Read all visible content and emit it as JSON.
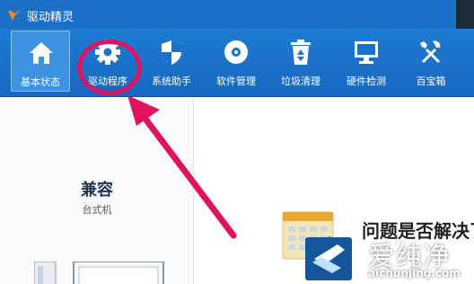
{
  "app": {
    "title": "驱动精灵"
  },
  "toolbar": {
    "items": [
      {
        "label": "基本状态",
        "icon": "home-icon",
        "active": true
      },
      {
        "label": "驱动程序",
        "icon": "gear-icon",
        "active": false
      },
      {
        "label": "系统助手",
        "icon": "shield-icon",
        "active": false
      },
      {
        "label": "软件管理",
        "icon": "disc-icon",
        "active": false
      },
      {
        "label": "垃圾清理",
        "icon": "recycle-bin-icon",
        "active": false
      },
      {
        "label": "硬件检测",
        "icon": "monitor-icon",
        "active": false
      },
      {
        "label": "百宝箱",
        "icon": "tools-icon",
        "active": false
      }
    ]
  },
  "left": {
    "compat": "兼容",
    "device": "台式机"
  },
  "right": {
    "question": "问题是否解决了"
  },
  "watermark": {
    "text": "爱纯净",
    "url": "aichunjing.com"
  },
  "colors": {
    "titlebar": "#1a6fc7",
    "toolbar": "#1f7bd3",
    "highlight": "#e0145e"
  }
}
